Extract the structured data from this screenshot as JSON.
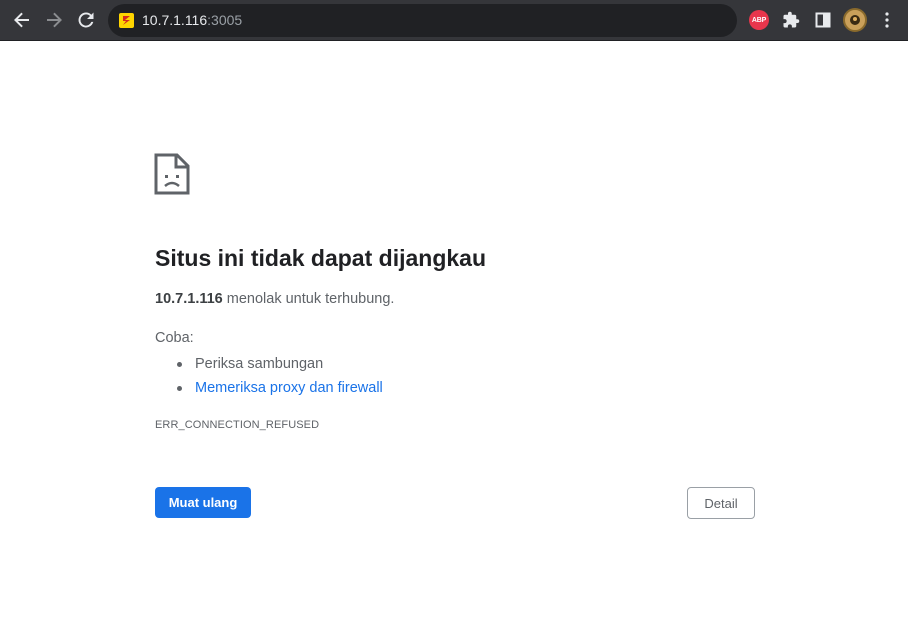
{
  "browser": {
    "url_host": "10.7.1.116",
    "url_port": ":3005",
    "extension_abp_label": "ABP",
    "icons": [
      "back-arrow-icon",
      "forward-arrow-icon",
      "reload-icon",
      "site-favicon-icon",
      "abp-extension-icon",
      "extensions-puzzle-icon",
      "side-panel-icon",
      "profile-avatar-icon",
      "more-menu-icon"
    ]
  },
  "error_page": {
    "title": "Situs ini tidak dapat dijangkau",
    "host": "10.7.1.116",
    "summary_rest": " menolak untuk terhubung.",
    "try_label": "Coba:",
    "suggestions": [
      "Periksa sambungan",
      "Memeriksa proxy dan firewall"
    ],
    "error_code": "ERR_CONNECTION_REFUSED",
    "reload_button": "Muat ulang",
    "details_button": "Detail"
  },
  "colors": {
    "toolbar": "#35363a",
    "omnibox": "#202124",
    "primary_button": "#1a73e8",
    "link": "#1a73e8",
    "text": "#5f6368",
    "title": "#202124"
  }
}
